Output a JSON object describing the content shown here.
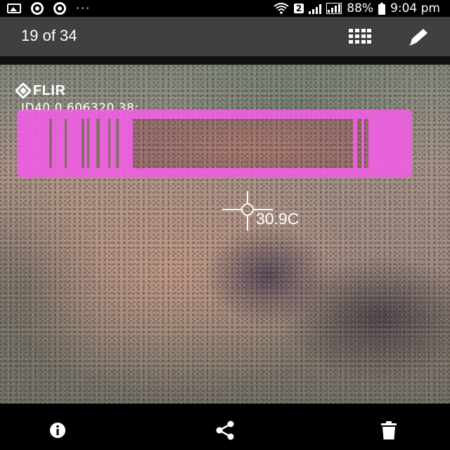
{
  "status_bar": {
    "left_icons": [
      "image-notification-icon",
      "chrome-icon",
      "chrome-icon"
    ],
    "overflow": "···",
    "network_badge": "2",
    "battery": "88%",
    "time": "9:04 pm"
  },
  "app_bar": {
    "title": "19 of 34",
    "grid_icon": "grid-icon",
    "edit_icon": "pencil-icon"
  },
  "photo": {
    "brand": "FLIR",
    "id_text": "ID40  0.606320  38:",
    "spot_temperature": "30.9C",
    "colors": {
      "overlay": "#ee5fe1"
    }
  },
  "bottom_bar": {
    "icons": [
      "info-icon",
      "share-icon",
      "delete-icon"
    ]
  }
}
